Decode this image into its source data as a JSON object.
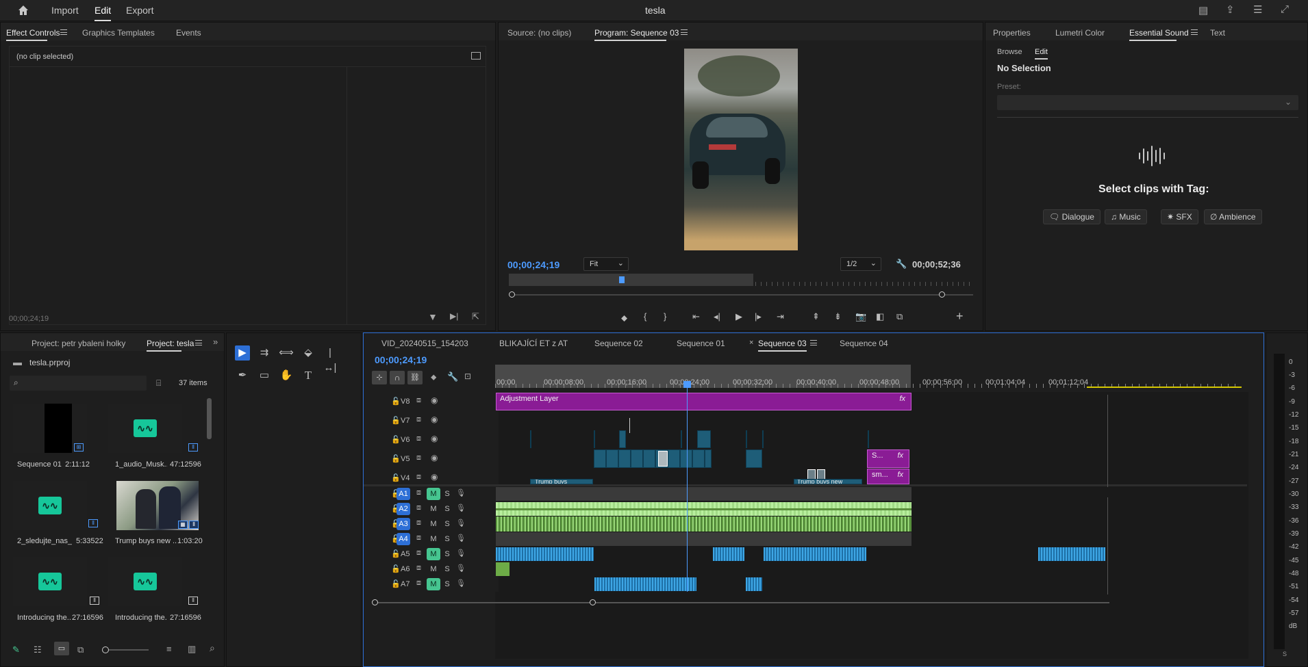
{
  "topbar": {
    "title": "tesla",
    "nav": [
      "Import",
      "Edit",
      "Export"
    ],
    "active_nav": "Edit"
  },
  "effect_controls": {
    "tabs": [
      "Effect Controls",
      "Graphics Templates",
      "Events"
    ],
    "no_clip": "(no clip selected)",
    "timecode": "00;00;24;19"
  },
  "monitor": {
    "source_tab": "Source: (no clips)",
    "program_tab": "Program: Sequence 03",
    "timecode": "00;00;24;19",
    "fit": "Fit",
    "resolution": "1/2",
    "duration": "00;00;52;36"
  },
  "essential_sound": {
    "tabs": [
      "Properties",
      "Lumetri Color",
      "Essential Sound",
      "Text"
    ],
    "subtabs": [
      "Browse",
      "Edit"
    ],
    "no_selection": "No Selection",
    "preset_label": "Preset:",
    "prompt": "Select clips with Tag:",
    "tags": [
      "Dialogue",
      "Music",
      "SFX",
      "Ambience"
    ]
  },
  "project": {
    "tabs": [
      "Project: petr ybaleni holky",
      "Project: tesla"
    ],
    "file": "tesla.prproj",
    "count": "37 items",
    "items": [
      {
        "name": "Sequence 01",
        "dur": "2:11:12",
        "kind": "sequence"
      },
      {
        "name": "1_audio_Musk...",
        "dur": "47:12596",
        "kind": "audio"
      },
      {
        "name": "2_sledujte_nas_...",
        "dur": "5:33522",
        "kind": "audio"
      },
      {
        "name": "Trump buys new ...",
        "dur": "1:03:20",
        "kind": "video"
      },
      {
        "name": "Introducing the...",
        "dur": "27:16596",
        "kind": "audio"
      },
      {
        "name": "Introducing the...",
        "dur": "27:16596",
        "kind": "audio"
      }
    ]
  },
  "timeline": {
    "tabs": [
      "VID_20240515_154203",
      "BLIKAJÍCÍ ET z AT",
      "Sequence 02",
      "Sequence 01",
      "Sequence 03",
      "Sequence 04"
    ],
    "active_tab": "Sequence 03",
    "timecode": "00;00;24;19",
    "ruler": [
      "00;00",
      "00;00;08;00",
      "00;00;16;00",
      "00;00;24;00",
      "00;00;32;00",
      "00;00;40;00",
      "00;00;48;00",
      "00;00;56;00",
      "00;01;04;04",
      "00;01;12;04"
    ],
    "video_tracks": [
      "V8",
      "V7",
      "V6",
      "V5",
      "V4"
    ],
    "audio_tracks": [
      "A1",
      "A2",
      "A3",
      "A4",
      "A5",
      "A6",
      "A7"
    ],
    "clips": {
      "adjustment": "Adjustment Layer",
      "trump1": "Trump buys",
      "trump2": "Trump buys new",
      "s": "S...",
      "sm": "sm...",
      "fx": "fx"
    }
  },
  "meter": {
    "labels": [
      "0",
      "-3",
      "-6",
      "-9",
      "-12",
      "-15",
      "-18",
      "-21",
      "-24",
      "-27",
      "-30",
      "-33",
      "-36",
      "-39",
      "-42",
      "-45",
      "-48",
      "-51",
      "-54",
      "-57",
      "dB"
    ],
    "solo": "S"
  }
}
